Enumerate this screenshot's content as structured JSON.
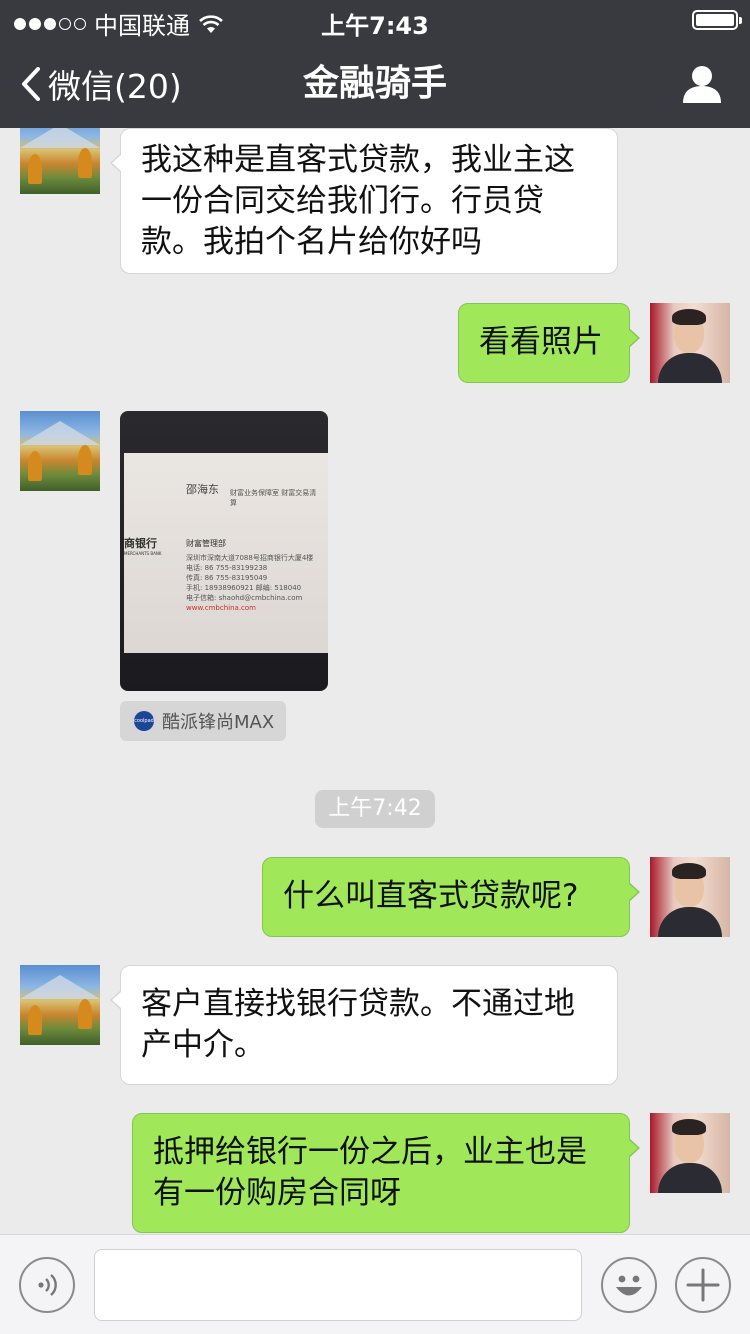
{
  "status": {
    "carrier": "中国联通",
    "time": "上午7:43"
  },
  "nav": {
    "back_label": "微信(20)",
    "title": "金融骑手"
  },
  "messages": [
    {
      "from": "other",
      "text": "我这种是直客式贷款，我业主这一份合同交给我们行。行员贷款。我拍个名片给你好吗"
    },
    {
      "from": "self",
      "text": "看看照片"
    },
    {
      "from": "other",
      "type": "image"
    },
    {
      "from": "self",
      "text": "什么叫直客式贷款呢?"
    },
    {
      "from": "other",
      "text": "客户直接找银行贷款。不通过地产中介。"
    },
    {
      "from": "self",
      "text": "抵押给银行一份之后，业主也是有一份购房合同呀"
    }
  ],
  "business_card": {
    "name": "邵海东",
    "title": "财富业务保障室 财富交易清算",
    "bank": "商银行",
    "bank_en": "MERCHANTS BANK",
    "dept": "财富管理部",
    "lines": [
      "深圳市深南大道7088号招商银行大厦4楼",
      "电话: 86 755-83199238",
      "传真: 86 755-83195049",
      "手机: 18938960921   邮编: 518040",
      "电子信箱: shaohd@cmbchina.com"
    ],
    "url": "www.cmbchina.com"
  },
  "device_tag": {
    "logo_text": "coolpad",
    "label": "酷派锋尚MAX"
  },
  "timestamp": "上午7:42",
  "input": {
    "value": "",
    "placeholder": ""
  }
}
